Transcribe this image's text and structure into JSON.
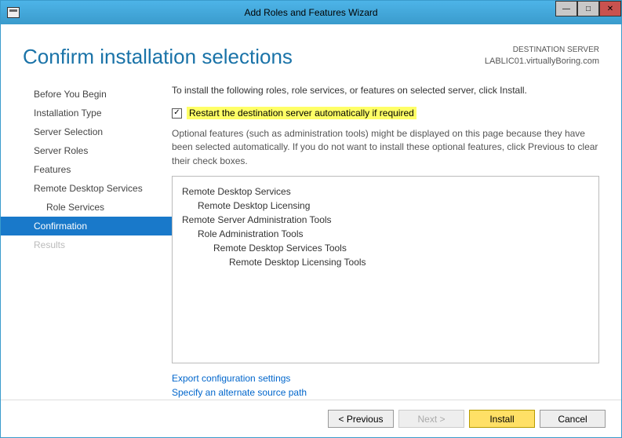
{
  "window": {
    "title": "Add Roles and Features Wizard"
  },
  "header": {
    "page_title": "Confirm installation selections",
    "dest_label": "DESTINATION SERVER",
    "dest_name": "LABLIC01.virtuallyBoring.com"
  },
  "sidebar": {
    "items": [
      {
        "label": "Before You Begin",
        "active": false,
        "disabled": false,
        "sub": false
      },
      {
        "label": "Installation Type",
        "active": false,
        "disabled": false,
        "sub": false
      },
      {
        "label": "Server Selection",
        "active": false,
        "disabled": false,
        "sub": false
      },
      {
        "label": "Server Roles",
        "active": false,
        "disabled": false,
        "sub": false
      },
      {
        "label": "Features",
        "active": false,
        "disabled": false,
        "sub": false
      },
      {
        "label": "Remote Desktop Services",
        "active": false,
        "disabled": false,
        "sub": false
      },
      {
        "label": "Role Services",
        "active": false,
        "disabled": false,
        "sub": true
      },
      {
        "label": "Confirmation",
        "active": true,
        "disabled": false,
        "sub": false
      },
      {
        "label": "Results",
        "active": false,
        "disabled": true,
        "sub": false
      }
    ]
  },
  "main": {
    "intro": "To install the following roles, role services, or features on selected server, click Install.",
    "checkbox_checked": true,
    "checkbox_label": "Restart the destination server automatically if required",
    "note": "Optional features (such as administration tools) might be displayed on this page because they have been selected automatically. If you do not want to install these optional features, click Previous to clear their check boxes.",
    "features": [
      {
        "label": "Remote Desktop Services",
        "level": 0
      },
      {
        "label": "Remote Desktop Licensing",
        "level": 1
      },
      {
        "label": "Remote Server Administration Tools",
        "level": 0
      },
      {
        "label": "Role Administration Tools",
        "level": 1
      },
      {
        "label": "Remote Desktop Services Tools",
        "level": 2
      },
      {
        "label": "Remote Desktop Licensing Tools",
        "level": 3
      }
    ],
    "links": {
      "export": "Export configuration settings",
      "source": "Specify an alternate source path"
    }
  },
  "footer": {
    "previous": "< Previous",
    "next": "Next >",
    "install": "Install",
    "cancel": "Cancel"
  }
}
